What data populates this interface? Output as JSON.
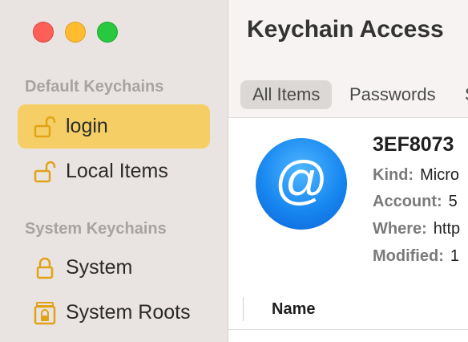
{
  "sidebar": {
    "default_title": "Default Keychains",
    "system_title": "System Keychains",
    "items": [
      {
        "label": "login",
        "icon": "unlocked-padlock-icon"
      },
      {
        "label": "Local Items",
        "icon": "unlocked-padlock-icon"
      },
      {
        "label": "System",
        "icon": "locked-padlock-icon"
      },
      {
        "label": "System Roots",
        "icon": "cabinet-lock-icon"
      }
    ]
  },
  "toolbar": {
    "title": "Keychain Access",
    "tabs": [
      {
        "label": "All Items"
      },
      {
        "label": "Passwords"
      },
      {
        "label": "S"
      }
    ]
  },
  "detail": {
    "name": "3EF8073",
    "fields": [
      {
        "key": "Kind:",
        "value": "Micro"
      },
      {
        "key": "Account:",
        "value": "5"
      },
      {
        "key": "Where:",
        "value": "http"
      },
      {
        "key": "Modified:",
        "value": "1"
      }
    ]
  },
  "table": {
    "columns": [
      {
        "label": "Name"
      }
    ]
  },
  "colors": {
    "selection": "#f5cf65",
    "lock_icon": "#e0a317",
    "sidebar_bg": "#e9e4e1"
  }
}
